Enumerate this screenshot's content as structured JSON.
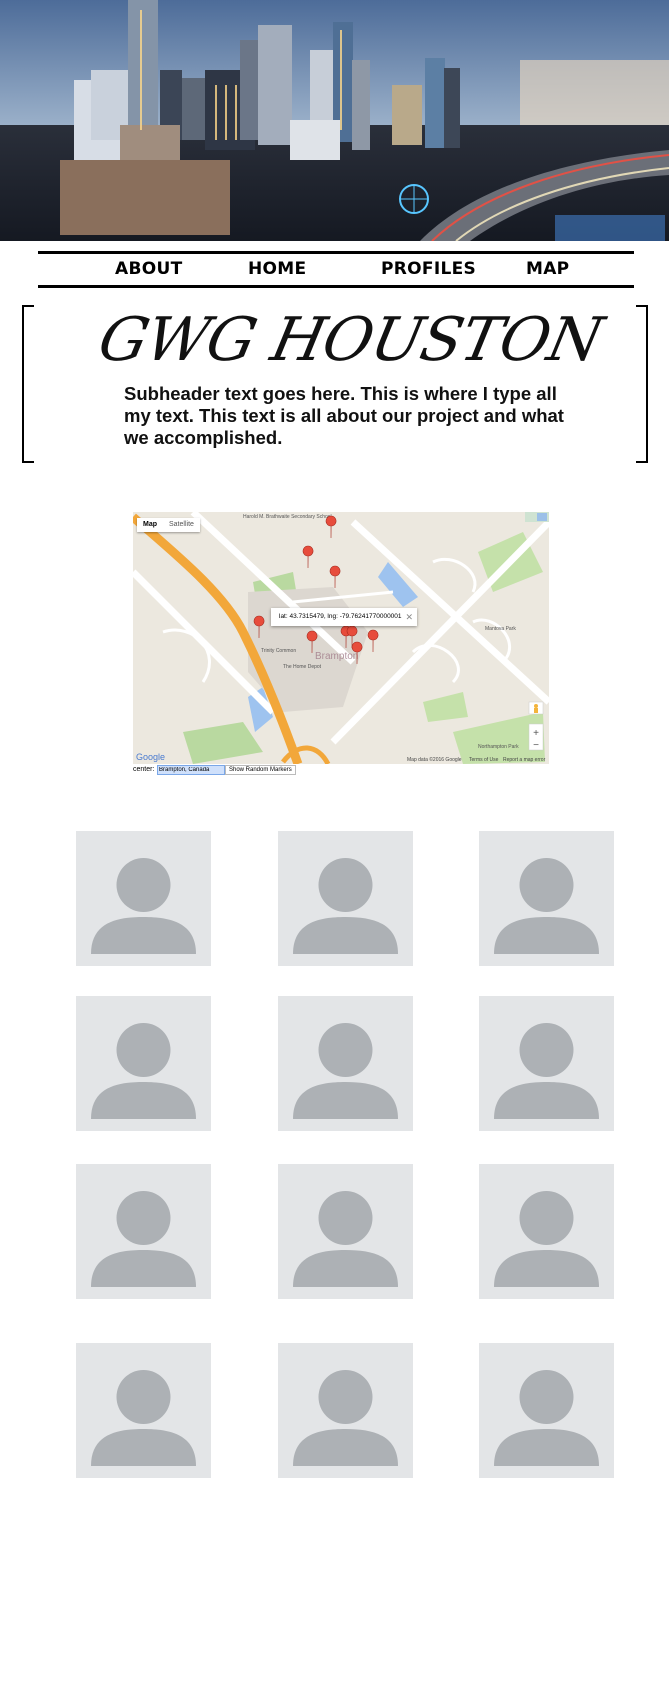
{
  "nav": {
    "items": [
      "ABOUT",
      "HOME",
      "PROFILES",
      "MAP"
    ]
  },
  "header": {
    "title": "GWG HOUSTON",
    "subheader": "Subheader text goes here. This is where I type all my text. This text is all about our project and what we accomplished."
  },
  "map": {
    "type_controls": [
      "Map",
      "Satellite"
    ],
    "infowindow_text": "lat: 43.7315479, lng: -79.76241770000001",
    "street_labels": [
      "Harold M. Brathwaite Secondary School",
      "Trinity Common",
      "The Home Depot",
      "Mantova Park",
      "Northampton Park",
      "Brampton"
    ],
    "footer": [
      "Map data ©2016 Google",
      "Terms of Use",
      "Report a map error"
    ],
    "google_logo": "Google",
    "center_label": "center:",
    "center_value": "Brampton, Canada",
    "random_markers_button": "Show Random Markers"
  },
  "profiles": {
    "count": 12,
    "icon": "person-placeholder-icon"
  },
  "colors": {
    "placeholder_bg": "#e3e5e7",
    "placeholder_silhouette": "#adb1b5",
    "highway": "#f2a73a",
    "marker": "#e74c3c"
  }
}
